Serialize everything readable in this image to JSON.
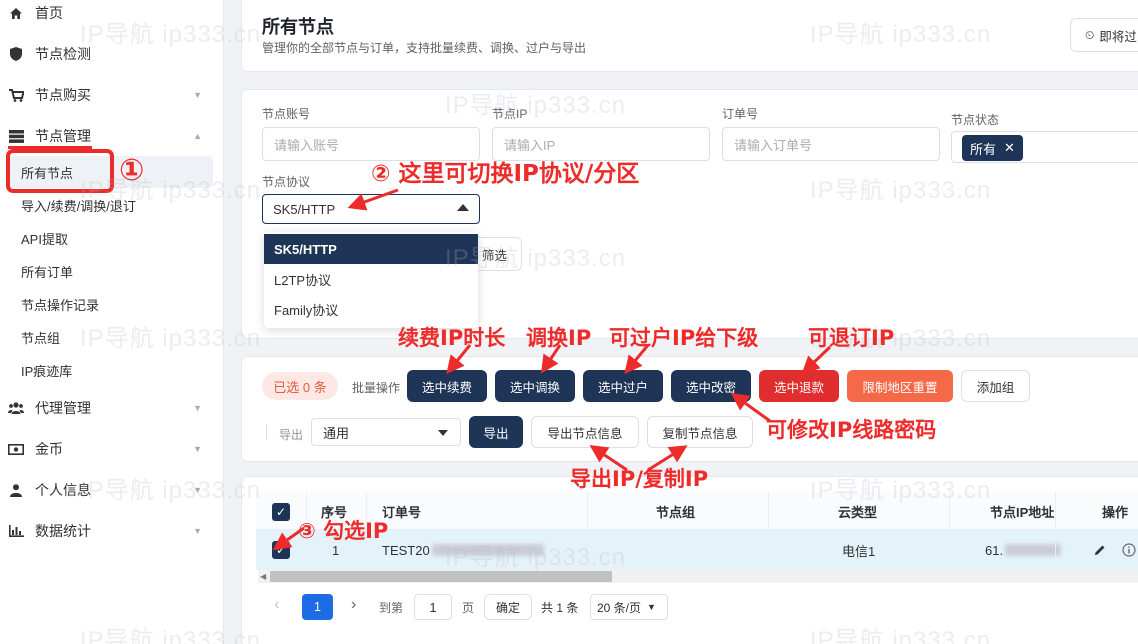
{
  "sidebar": {
    "items": [
      {
        "label": "首页",
        "icon": "home-icon"
      },
      {
        "label": "节点检测",
        "icon": "shield-icon"
      },
      {
        "label": "节点购买",
        "icon": "cart-icon"
      },
      {
        "label": "节点管理",
        "icon": "server-icon"
      },
      {
        "label": "代理管理",
        "icon": "users-icon"
      },
      {
        "label": "金币",
        "icon": "money-icon"
      },
      {
        "label": "个人信息",
        "icon": "user-icon"
      },
      {
        "label": "数据统计",
        "icon": "chart-icon"
      }
    ],
    "sub_items": [
      "所有节点",
      "导入/续费/调换/退订",
      "API提取",
      "所有订单",
      "节点操作记录",
      "节点组",
      "IP痕迹库"
    ]
  },
  "header": {
    "title": "所有节点",
    "subtitle": "管理你的全部节点与订单，支持批量续费、调换、过户与导出",
    "right_button": "即将过"
  },
  "filters": {
    "account_label": "节点账号",
    "account_placeholder": "请输入账号",
    "ip_label": "节点IP",
    "ip_placeholder": "请输入IP",
    "order_label": "订单号",
    "order_placeholder": "请输入订单号",
    "status_label": "节点状态",
    "status_tag": "所有",
    "protocol_label": "节点协议",
    "protocol_value": "SK5/HTTP",
    "protocol_options": [
      "SK5/HTTP",
      "L2TP协议",
      "Family协议"
    ],
    "filter_button_partial": "筛选"
  },
  "batch": {
    "selected_pill": "已选 0 条",
    "batch_label": "批量操作",
    "buttons": [
      "选中续费",
      "选中调换",
      "选中过户",
      "选中改密",
      "选中退款",
      "限制地区重置",
      "添加组"
    ],
    "export_label": "导出",
    "export_select": "通用",
    "export_button": "导出",
    "export_info_button": "导出节点信息",
    "copy_info_button": "复制节点信息"
  },
  "table": {
    "headers": [
      "序号",
      "订单号",
      "节点组",
      "云类型",
      "节点IP地址",
      "操作"
    ],
    "rows": [
      {
        "index": "1",
        "order_prefix": "TEST20",
        "group": "",
        "cloud": "电信1",
        "ip_prefix": "61."
      }
    ]
  },
  "pagination": {
    "current_page": "1",
    "goto_label": "到第",
    "goto_value": "1",
    "page_suffix": "页",
    "confirm": "确定",
    "total": "共 1 条",
    "page_size": "20 条/页"
  },
  "annotations": {
    "a1": "①",
    "a2": "② 这里可切换IP协议/分区",
    "a3": "③ 勾选IP",
    "renew": "续费IP时长",
    "swap": "调换IP",
    "transfer": "可过户IP给下级",
    "refund": "可退订IP",
    "password": "可修改IP线路密码",
    "export": "导出IP/复制IP"
  },
  "watermark": "IP导航 ip333.cn",
  "colors": {
    "primary": "#1f3557",
    "danger": "#e02d2d",
    "orange": "#f46a48",
    "annotation": "#ee2b2b"
  }
}
